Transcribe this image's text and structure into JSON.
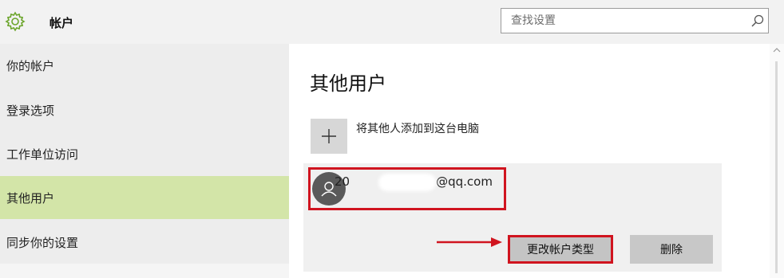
{
  "header": {
    "title": "帐户",
    "search_placeholder": "查找设置"
  },
  "sidebar": {
    "items": [
      {
        "label": "你的帐户"
      },
      {
        "label": "登录选项"
      },
      {
        "label": "工作单位访问"
      },
      {
        "label": "其他用户",
        "selected": true
      },
      {
        "label": "同步你的设置"
      }
    ]
  },
  "main": {
    "title": "其他用户",
    "add_label": "将其他人添加到这台电脑",
    "account": {
      "email_prefix": "20",
      "email_suffix": "@qq.com"
    },
    "buttons": {
      "change_type": "更改帐户类型",
      "delete": "删除"
    }
  },
  "colors": {
    "accent_selected": "#d3e5a8",
    "highlight_red": "#d0141f",
    "icon_green": "#6ca52c"
  }
}
